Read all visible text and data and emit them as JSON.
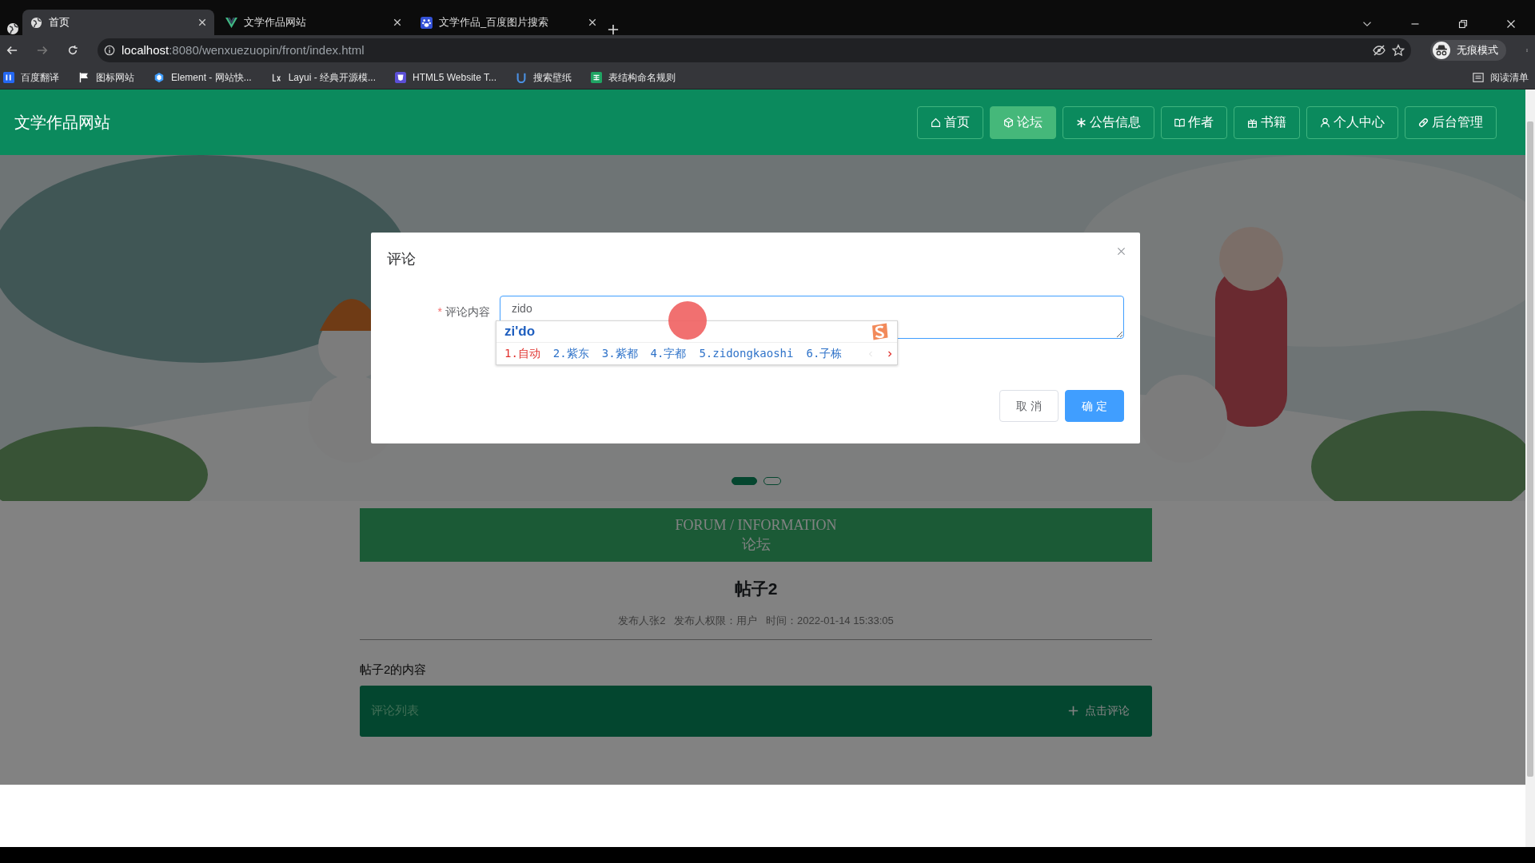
{
  "browser": {
    "tabs": [
      {
        "title": "首页",
        "selected": true
      },
      {
        "title": "文学作品网站",
        "selected": false
      },
      {
        "title": "文学作品_百度图片搜索",
        "selected": false
      }
    ],
    "address": {
      "host": "localhost",
      "rest": ":8080/wenxuezuopin/front/index.html"
    },
    "bookmarks": [
      {
        "label": "百度翻译"
      },
      {
        "label": "图标网站"
      },
      {
        "label": "Element - 网站快..."
      },
      {
        "label": "Layui - 经典开源模..."
      },
      {
        "label": "HTML5 Website T..."
      },
      {
        "label": "搜索壁纸"
      },
      {
        "label": "表结构命名规则"
      }
    ],
    "profile": "无痕模式",
    "reading_list": "阅读清单"
  },
  "site": {
    "title": "文学作品网站",
    "nav": [
      {
        "label": "首页",
        "selected": false
      },
      {
        "label": "论坛",
        "selected": true
      },
      {
        "label": "公告信息",
        "selected": false
      },
      {
        "label": "作者",
        "selected": false
      },
      {
        "label": "书籍",
        "selected": false
      },
      {
        "label": "个人中心",
        "selected": false
      },
      {
        "label": "后台管理",
        "selected": false
      }
    ],
    "carousel_dots": [
      {
        "selected": true
      },
      {
        "selected": false
      }
    ],
    "section": {
      "title_en": "FORUM / INFORMATION",
      "title_cn": "论坛"
    },
    "post": {
      "title": "帖子2",
      "meta": "发布人张2   发布人权限：用户   时间：2022-01-14 15:33:05",
      "content": "帖子2的内容"
    },
    "comments_bar": {
      "label": "评论列表",
      "action": "点击评论"
    }
  },
  "dialog": {
    "title": "评论",
    "field": {
      "required_mark": "*",
      "label": "评论内容",
      "value": "zido"
    },
    "ime": {
      "composition": "zi'do",
      "candidates": [
        {
          "text": "1.自动",
          "selected": true
        },
        {
          "text": "2.紫东",
          "selected": false
        },
        {
          "text": "3.紫都",
          "selected": false
        },
        {
          "text": "4.字都",
          "selected": false
        },
        {
          "text": "5.zidongkaoshi",
          "selected": false
        },
        {
          "text": "6.子栋",
          "selected": false
        }
      ]
    },
    "buttons": [
      {
        "label": "取 消",
        "kind": "default"
      },
      {
        "label": "确 定",
        "kind": "primary"
      }
    ]
  }
}
